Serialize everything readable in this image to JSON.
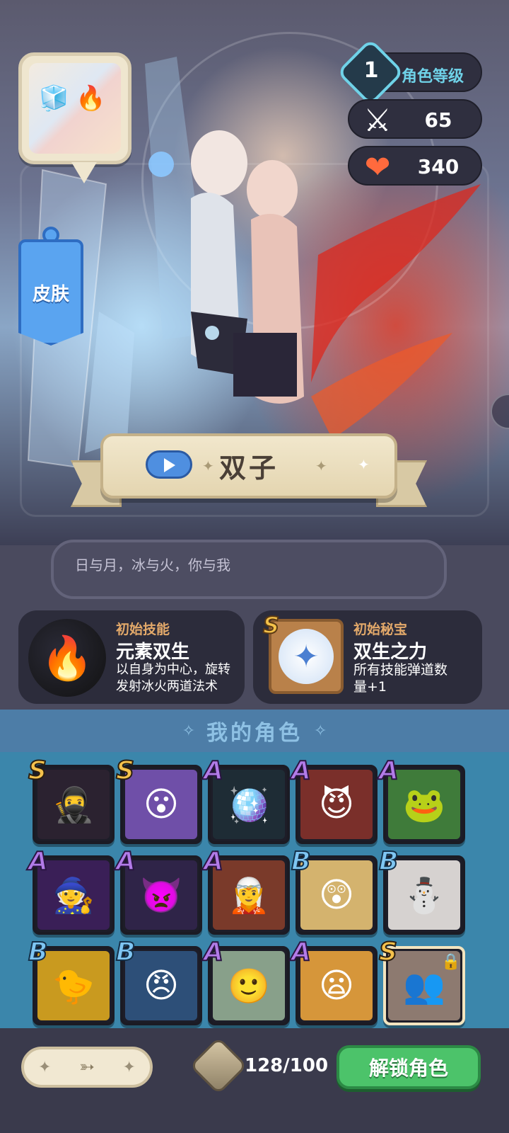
{
  "character": {
    "name": "双子",
    "quote": "日与月，冰与火，你与我"
  },
  "skin": {
    "label": "皮肤"
  },
  "stats": {
    "level": "1",
    "level_label": "角色等级",
    "attack": "65",
    "health": "340",
    "attack_icon": "sword-icon",
    "health_icon": "heart-icon",
    "level_icon": "level-badge-icon"
  },
  "initial_skill": {
    "title": "初始技能",
    "name": "元素双生",
    "desc_line1": "以自身为中心，旋转",
    "desc_line2": "发射冰火两道法术",
    "icon": "ice-fire-skill-icon"
  },
  "initial_relic": {
    "title": "初始秘宝",
    "grade": "S",
    "name": "双生之力",
    "desc_line1": "所有技能弹道数",
    "desc_line2": "量+1",
    "icon": "twin-star-relic-icon"
  },
  "roster": {
    "title": "我的角色",
    "characters": [
      {
        "grade": "S",
        "icon": "masked-ninja-icon",
        "bg": "#2b2230"
      },
      {
        "grade": "S",
        "icon": "purple-hair-girl-icon",
        "bg": "#6f4fa8"
      },
      {
        "grade": "A",
        "icon": "disco-ball-helmet-icon",
        "bg": "#1e2c35"
      },
      {
        "grade": "A",
        "icon": "red-hair-boy-icon",
        "bg": "#7a2f2a"
      },
      {
        "grade": "A",
        "icon": "frog-icon",
        "bg": "#3f7b3a"
      },
      {
        "grade": "A",
        "icon": "shadow-wizard-icon",
        "bg": "#3a1f57"
      },
      {
        "grade": "A",
        "icon": "demon-boy-icon",
        "bg": "#2f2448"
      },
      {
        "grade": "A",
        "icon": "blonde-witch-icon",
        "bg": "#7a3a2a"
      },
      {
        "grade": "B",
        "icon": "blonde-girl-icon",
        "bg": "#d4b36e"
      },
      {
        "grade": "B",
        "icon": "snowman-icon",
        "bg": "#d6d2d0"
      },
      {
        "grade": "B",
        "icon": "yellow-bird-icon",
        "bg": "#c99a1f"
      },
      {
        "grade": "B",
        "icon": "blue-hair-boy-icon",
        "bg": "#2d4f78"
      },
      {
        "grade": "A",
        "icon": "green-hair-girl-icon",
        "bg": "#88a08a"
      },
      {
        "grade": "A",
        "icon": "blonde-boy-icon",
        "bg": "#d6963a"
      },
      {
        "grade": "S",
        "icon": "twins-locked-icon",
        "bg": "#8d7a70",
        "locked": true,
        "selected": true
      }
    ]
  },
  "bottom": {
    "shard_count": "128/100",
    "unlock_label": "解锁角色",
    "shard_icon": "character-shard-icon"
  }
}
